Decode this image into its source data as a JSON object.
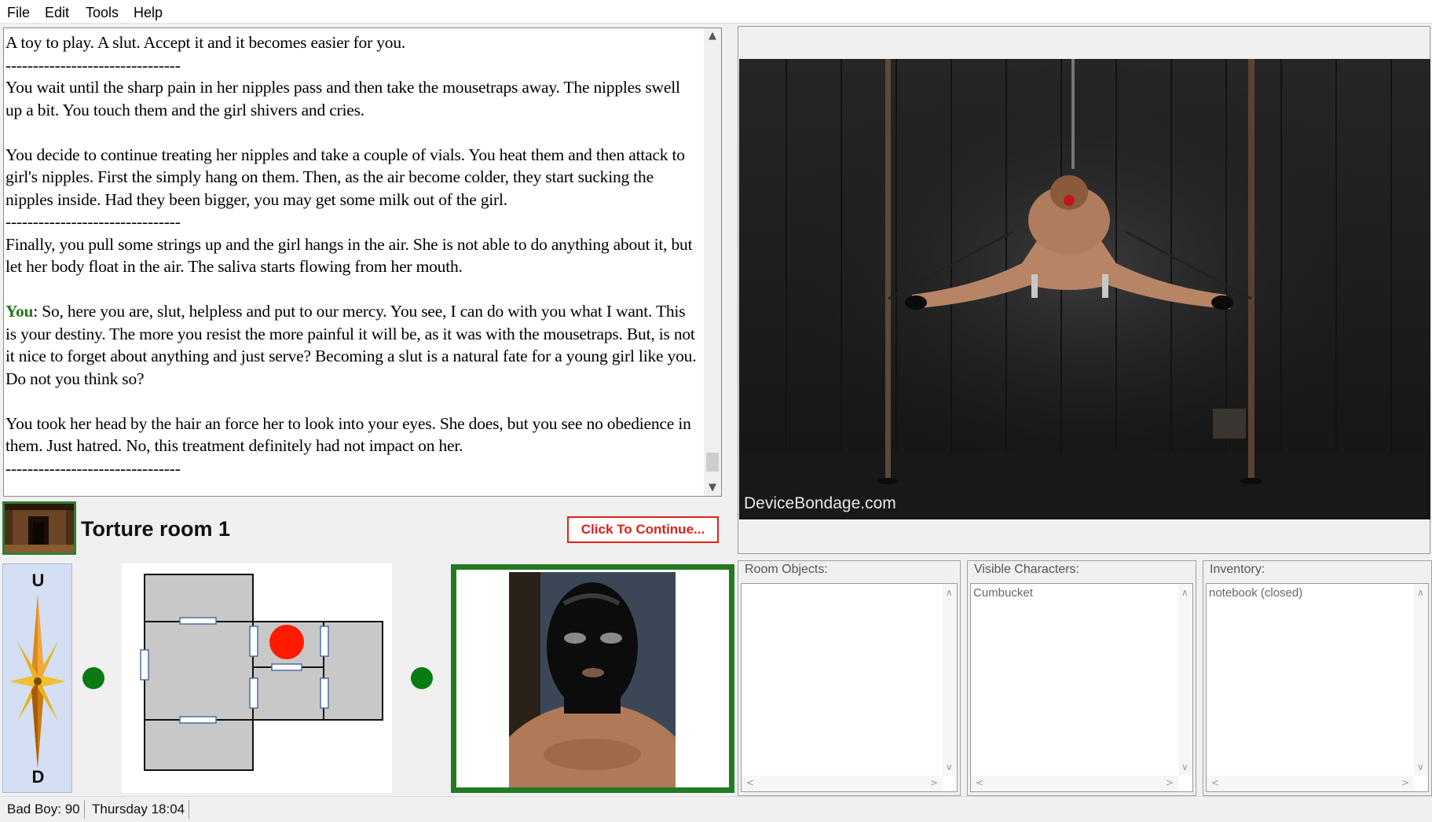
{
  "menu": [
    "File",
    "Edit",
    "Tools",
    "Help"
  ],
  "log": {
    "line1": "A toy to play. A slut. Accept it and it becomes easier for you.",
    "sep": "--------------------------------",
    "p1": "You wait until the sharp pain in her nipples pass and then take the mousetraps away. The nipples swell up a bit. You touch them and the girl shivers and cries.",
    "p2": "You decide to continue treating her nipples and take a couple of vials. You heat them and then attack to girl's nipples. First the simply hang on them. Then, as the air become colder, they start sucking the nipples inside. Had they been bigger, you may get some milk out of the girl.",
    "p3": "Finally, you pull some strings up and the girl hangs in the air. She is not able to do anything about it, but let her body float in the air. The saliva starts flowing from her mouth.",
    "speaker": "You",
    "p4": ": So, here you are, slut, helpless and put to our mercy. You see, I can do with you what I want. This is your destiny. The more you resist the more painful it will be, as it was with the mousetraps. But, is not it nice to forget about anything and just serve? Becoming a slut is a natural fate for a young girl like you. Do not you think so?",
    "p5": "You took her head by the hair an force her to look into your eyes. She does, but you see no obedience in them. Just hatred. No, this treatment definitely had not impact on her."
  },
  "location": {
    "name": "Torture room 1",
    "continue_label": "Click To Continue..."
  },
  "scene": {
    "watermark": "DeviceBondage.com"
  },
  "compass": {
    "up": "U",
    "down": "D"
  },
  "panels": {
    "room_objects": {
      "label": "Room Objects:",
      "items": []
    },
    "visible_characters": {
      "label": "Visible Characters:",
      "items": [
        "Cumbucket"
      ]
    },
    "inventory": {
      "label": "Inventory:",
      "items": [
        "notebook (closed)"
      ]
    }
  },
  "status": {
    "bad_boy": "Bad Boy: 90",
    "time": "Thursday 18:04"
  },
  "colors": {
    "speaker_green": "#1f7a1f",
    "continue_red": "#e0201a",
    "frame_green": "#237a23",
    "map_room_gray": "#c8c8c8",
    "player_marker_red": "#ff1a00",
    "exit_marker_green": "#0a7a12"
  }
}
